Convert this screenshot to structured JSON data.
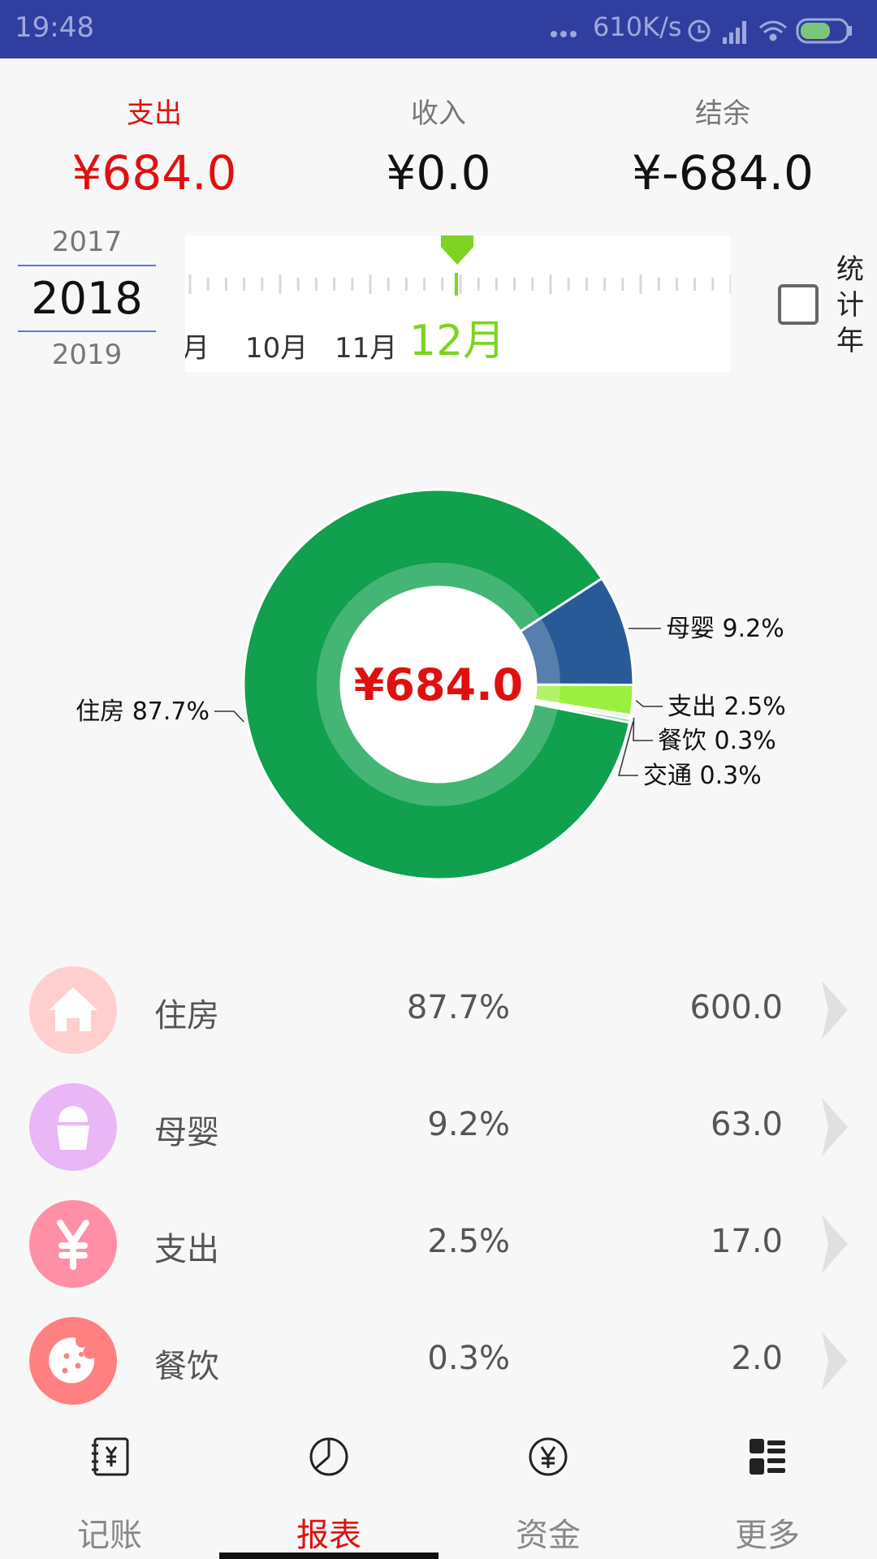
{
  "status_bar": {
    "time": "19:48",
    "speed": "610K/s",
    "battery": "59"
  },
  "summary": {
    "expense": {
      "label": "支出",
      "value": "¥684.0"
    },
    "income": {
      "label": "收入",
      "value": "¥0.0"
    },
    "balance": {
      "label": "结余",
      "value": "¥-684.0"
    }
  },
  "year_picker": {
    "prev": "2017",
    "current": "2018",
    "next": "2019"
  },
  "month_ruler": {
    "partial": "月",
    "m10": "10月",
    "m11": "11月",
    "current": "12月"
  },
  "year_stats": {
    "label": "统计年",
    "checked": false
  },
  "chart_data": {
    "type": "pie",
    "center_label": "¥684.0",
    "slices": [
      {
        "label": "住房 87.7%",
        "name": "住房",
        "percent": 87.7,
        "color": "#10a04e"
      },
      {
        "label": "母婴 9.2%",
        "name": "母婴",
        "percent": 9.2,
        "color": "#285a97"
      },
      {
        "label": "支出 2.5%",
        "name": "支出",
        "percent": 2.5,
        "color": "#9aef3f"
      },
      {
        "label": "餐饮 0.3%",
        "name": "餐饮",
        "percent": 0.3,
        "color": "#e6e6e6"
      },
      {
        "label": "交通 0.3%",
        "name": "交通",
        "percent": 0.3,
        "color": "#6ad39b"
      }
    ]
  },
  "categories": [
    {
      "name": "住房",
      "percent": "87.7%",
      "amount": "600.0",
      "icon": "house-icon",
      "color": "#ffcfcf"
    },
    {
      "name": "母婴",
      "percent": "9.2%",
      "amount": "63.0",
      "icon": "cup-icon",
      "color": "#e9b6f6"
    },
    {
      "name": "支出",
      "percent": "2.5%",
      "amount": "17.0",
      "icon": "yen-icon",
      "color": "#ff8fa6"
    },
    {
      "name": "餐饮",
      "percent": "0.3%",
      "amount": "2.0",
      "icon": "cookie-icon",
      "color": "#ff8080"
    }
  ],
  "nav": {
    "tabs": [
      {
        "label": "记账",
        "icon": "ledger-icon"
      },
      {
        "label": "报表",
        "icon": "chart-icon",
        "active": true
      },
      {
        "label": "资金",
        "icon": "fund-icon"
      },
      {
        "label": "更多",
        "icon": "grid-icon"
      }
    ]
  }
}
